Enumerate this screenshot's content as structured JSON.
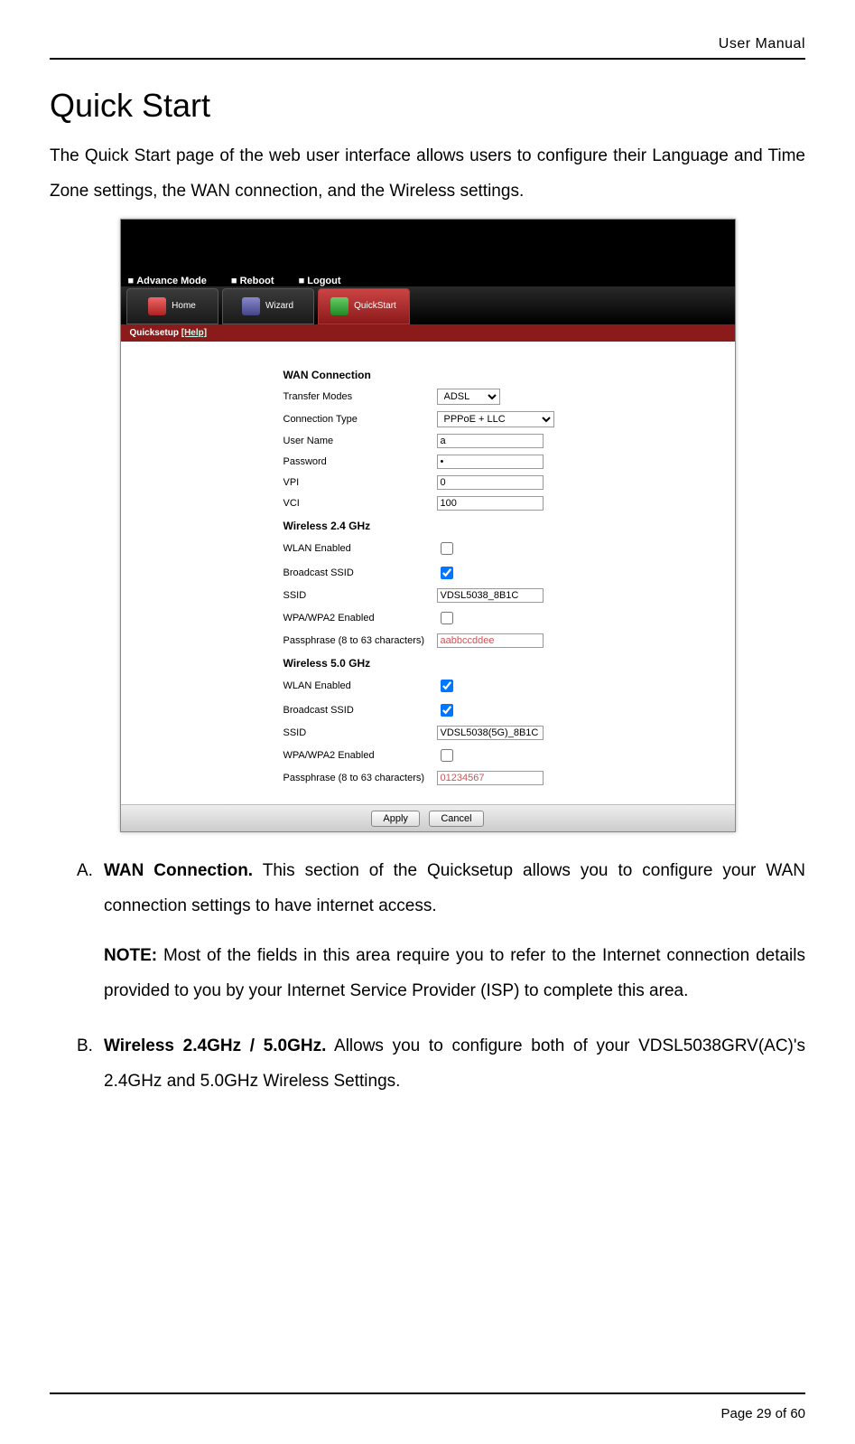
{
  "header": {
    "right": "User Manual"
  },
  "title": "Quick Start",
  "intro": "The Quick Start page of the web user interface allows users to configure their Language and Time Zone settings, the WAN connection, and the Wireless settings.",
  "screenshot": {
    "menu": {
      "advance": "Advance Mode",
      "reboot": "Reboot",
      "logout": "Logout"
    },
    "tabs": {
      "home": "Home",
      "wizard": "Wizard",
      "quickstart": "QuickStart"
    },
    "breadcrumb_label": "Quicksetup",
    "breadcrumb_help": "[Help]",
    "sections": {
      "wan": {
        "title": "WAN Connection",
        "transfer_modes": {
          "label": "Transfer Modes",
          "value": "ADSL"
        },
        "connection_type": {
          "label": "Connection Type",
          "value": "PPPoE + LLC"
        },
        "user_name": {
          "label": "User Name",
          "value": "a"
        },
        "password": {
          "label": "Password",
          "value": "•"
        },
        "vpi": {
          "label": "VPI",
          "value": "0"
        },
        "vci": {
          "label": "VCI",
          "value": "100"
        }
      },
      "wl24": {
        "title": "Wireless 2.4 GHz",
        "wlan_enabled": {
          "label": "WLAN Enabled",
          "checked": false
        },
        "broadcast_ssid": {
          "label": "Broadcast SSID",
          "checked": true
        },
        "ssid": {
          "label": "SSID",
          "value": "VDSL5038_8B1C"
        },
        "wpa_enabled": {
          "label": "WPA/WPA2 Enabled",
          "checked": false
        },
        "passphrase": {
          "label": "Passphrase (8 to 63 characters)",
          "value": "aabbccddee"
        }
      },
      "wl50": {
        "title": "Wireless 5.0 GHz",
        "wlan_enabled": {
          "label": "WLAN Enabled",
          "checked": true
        },
        "broadcast_ssid": {
          "label": "Broadcast SSID",
          "checked": true
        },
        "ssid": {
          "label": "SSID",
          "value": "VDSL5038(5G)_8B1C"
        },
        "wpa_enabled": {
          "label": "WPA/WPA2 Enabled",
          "checked": false
        },
        "passphrase": {
          "label": "Passphrase (8 to 63 characters)",
          "value": "01234567"
        }
      }
    },
    "buttons": {
      "apply": "Apply",
      "cancel": "Cancel"
    }
  },
  "items": [
    {
      "marker": "A.",
      "title": "WAN Connection.",
      "body": " This section of the Quicksetup allows you to configure your WAN connection settings to have internet access.",
      "note_label": "NOTE:",
      "note_body": " Most of the fields in this area require you to refer to the Internet connection details provided to you by your Internet Service Provider (ISP) to complete this area."
    },
    {
      "marker": "B.",
      "title": "Wireless 2.4GHz / 5.0GHz.",
      "body": " Allows you to configure both of your VDSL5038GRV(AC)'s 2.4GHz and 5.0GHz Wireless Settings."
    }
  ],
  "footer": {
    "page_label": "Page",
    "page_num": "29",
    "of": "of",
    "total": "60"
  }
}
